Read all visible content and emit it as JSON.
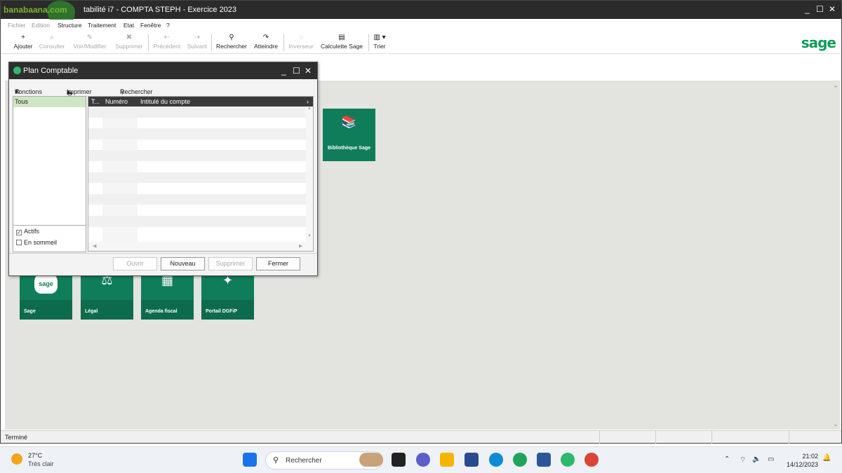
{
  "app": {
    "title": "banabaana.com - Comptabilité i7 - COMPTA STEPH - Exercice 2023",
    "title_visible": "tabilité i7 - COMPTA STEPH - Exercice 2023",
    "watermark": "banabaana.com",
    "min": "_",
    "max": "☐",
    "close": "✕"
  },
  "menu": [
    "Fichier",
    "Edition",
    "Structure",
    "Traitement",
    "Etat",
    "Fenêtre",
    "?"
  ],
  "toolbar": [
    {
      "label": "Ajouter",
      "icon": "+"
    },
    {
      "label": "Consulter",
      "icon": "⌕"
    },
    {
      "label": "Voir/Modifier",
      "icon": "✎"
    },
    {
      "label": "Supprimer",
      "icon": "✖"
    },
    {
      "label": "Précédent",
      "icon": "⇠"
    },
    {
      "label": "Suivant",
      "icon": "⇢"
    },
    {
      "label": "Rechercher",
      "icon": "🔍"
    },
    {
      "label": "Atteindre",
      "icon": "↷"
    },
    {
      "label": "Inverseur",
      "icon": "◌"
    },
    {
      "label": "Calculette Sage",
      "icon": "▤"
    },
    {
      "label": "Trier",
      "icon": "▥ ▾"
    }
  ],
  "brand": {
    "sage": "sage",
    "color": "#0f9d58"
  },
  "tiles": [
    {
      "label": "Bibliothèque Sage"
    },
    {
      "label": "Sage"
    },
    {
      "label": "Légal"
    },
    {
      "label": "Agenda fiscal"
    },
    {
      "label": "Portail DGFiP"
    }
  ],
  "status": {
    "text": "Terminé"
  },
  "dialog": {
    "title": "Plan Comptable",
    "tools": {
      "fonctions": "Fonctions",
      "imprimer": "Imprimer",
      "rechercher": "Rechercher"
    },
    "left_list": {
      "selected": "Tous"
    },
    "checks": [
      {
        "label": "Actifs",
        "checked": true
      },
      {
        "label": "En sommeil",
        "checked": false
      }
    ],
    "columns": [
      "T...",
      "Numéro",
      "Intitulé du compte"
    ],
    "buttons": {
      "ouvrir": "Ouvrir",
      "nouveau": "Nouveau",
      "supprimer": "Supprimer",
      "fermer": "Fermer"
    }
  },
  "taskbar": {
    "weather_temp": "27°C",
    "weather_desc": "Très clair",
    "search": "Rechercher",
    "time": "21:02",
    "date": "14/12/2023"
  }
}
